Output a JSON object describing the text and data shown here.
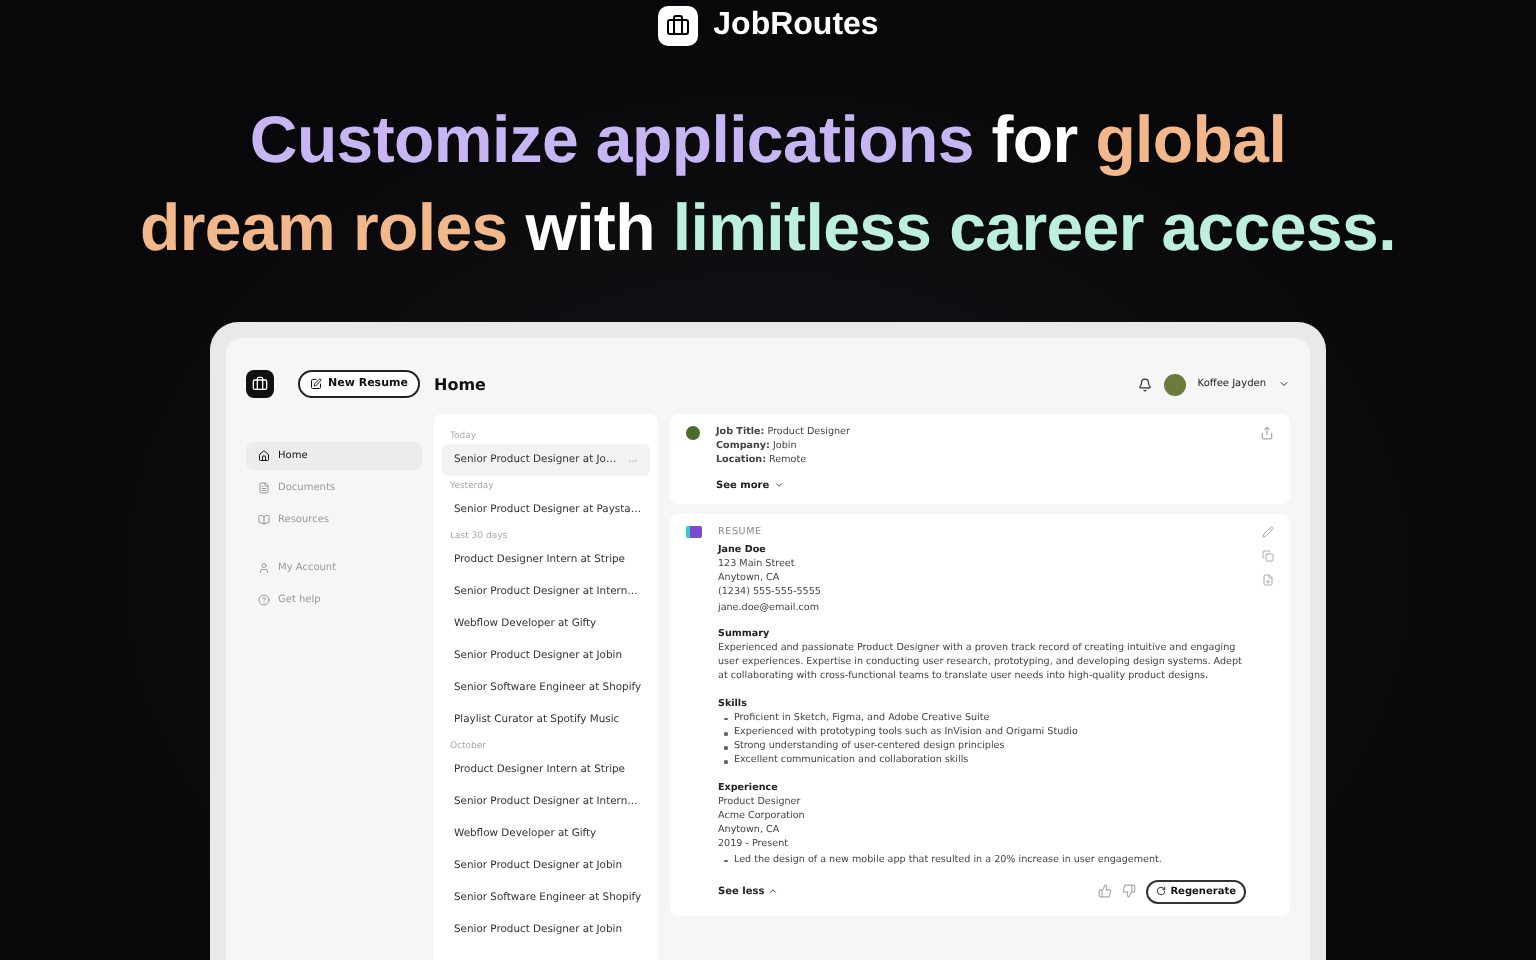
{
  "brand": {
    "name": "JobRoutes"
  },
  "headline": {
    "lines": [
      [
        {
          "text": "Customize applications",
          "color": "#c7b6f3"
        },
        {
          "text": " for ",
          "color": "#ffffff"
        },
        {
          "text": "global",
          "color": "#f2b88c"
        }
      ],
      [
        {
          "text": "dream roles",
          "color": "#f2b88c"
        },
        {
          "text": " with ",
          "color": "#ffffff"
        },
        {
          "text": "limitless career access.",
          "color": "#bdf0dc"
        }
      ]
    ]
  },
  "app": {
    "new_resume": "New Resume",
    "page_title": "Home",
    "user": {
      "name": "Koffee Jayden"
    },
    "nav": [
      {
        "label": "Home",
        "selected": true
      },
      {
        "label": "Documents",
        "selected": false
      },
      {
        "label": "Resources",
        "selected": false
      },
      {
        "label": "My Account",
        "selected": false
      },
      {
        "label": "Get help",
        "selected": false
      }
    ],
    "history": [
      {
        "heading": "Today",
        "items": [
          {
            "label": "Senior Product Designer at Jo…",
            "selected": true
          }
        ]
      },
      {
        "heading": "Yesterday",
        "items": [
          {
            "label": "Senior Product Designer at Paysta…",
            "selected": false
          }
        ]
      },
      {
        "heading": "Last 30 days",
        "items": [
          {
            "label": "Product Designer Intern at Stripe",
            "selected": false
          },
          {
            "label": "Senior Product Designer at Intern…",
            "selected": false
          },
          {
            "label": "Webflow Developer at Gifty",
            "selected": false
          },
          {
            "label": "Senior Product Designer at Jobin",
            "selected": false
          },
          {
            "label": "Senior Software Engineer at Shopify",
            "selected": false
          },
          {
            "label": "Playlist Curator at Spotify Music",
            "selected": false
          }
        ]
      },
      {
        "heading": "October",
        "items": [
          {
            "label": "Product Designer Intern at Stripe",
            "selected": false
          },
          {
            "label": "Senior Product Designer at Intern…",
            "selected": false
          },
          {
            "label": "Webflow Developer at Gifty",
            "selected": false
          },
          {
            "label": "Senior Product Designer at Jobin",
            "selected": false
          },
          {
            "label": "Senior Software Engineer at Shopify",
            "selected": false
          },
          {
            "label": "Senior Product Designer at Jobin",
            "selected": false
          }
        ]
      }
    ],
    "job": {
      "lines": [
        "**Job Title:** Product Designer",
        "**Company:** Jobin",
        "**Location:** Remote"
      ],
      "see_more": "See more"
    },
    "resume": {
      "label": "RESUME",
      "name": "Jane Doe",
      "contact": [
        "123 Main Street",
        "Anytown, CA",
        "(1234) 555-555-5555",
        "jane.doe@email.com"
      ],
      "summary_title": "Summary",
      "summary": "Experienced and passionate Product Designer with a proven track record of creating intuitive and engaging user experiences. Expertise in conducting user research, prototyping, and developing design systems. Adept at collaborating with cross-functional teams to translate user needs into high-quality product designs.",
      "skills_title": "Skills",
      "skills": [
        "Proficient in Sketch, Figma, and Adobe Creative Suite",
        "Experienced with prototyping tools such as InVision and Origami Studio",
        "Strong understanding of user-centered design principles",
        "Excellent communication and collaboration skills"
      ],
      "experience_title": "Experience",
      "experience": [
        "Product Designer",
        "Acme Corporation",
        "Anytown, CA",
        "2019 - Present"
      ],
      "experience_bullets": [
        "Led the design of a new mobile app that resulted in a 20% increase in user engagement."
      ],
      "see_less": "See less",
      "regenerate": "Regenerate"
    }
  }
}
